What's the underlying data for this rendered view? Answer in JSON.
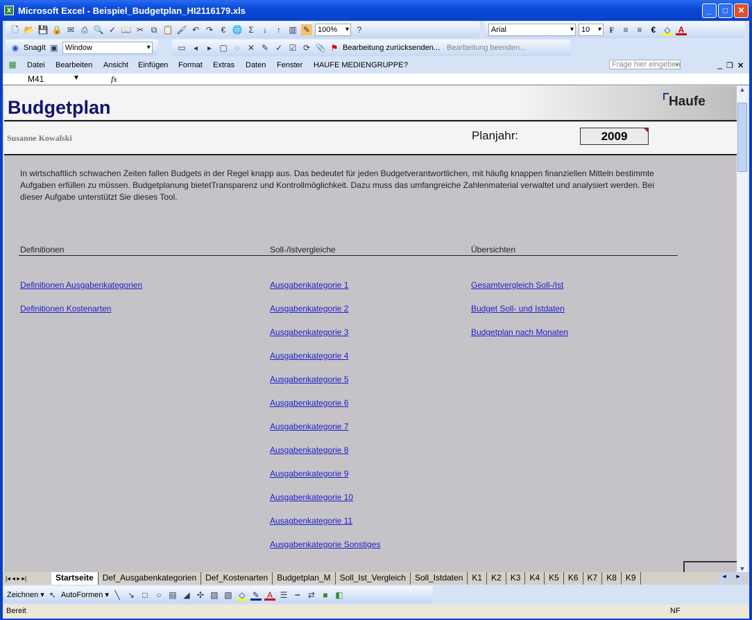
{
  "window": {
    "title": "Microsoft Excel - Beispiel_Budgetplan_HI2116179.xls"
  },
  "toolbar": {
    "zoom": "100%",
    "font": "Arial",
    "font_size": "10",
    "bold": "F",
    "euro": "€"
  },
  "toolbar2": {
    "snagit": "SnagIt",
    "window_combo": "Window",
    "send_back": "Bearbeitung zurücksenden...",
    "end_edit": "Bearbeitung beenden..."
  },
  "menu": {
    "items": [
      "Datei",
      "Bearbeiten",
      "Ansicht",
      "Einfügen",
      "Format",
      "Extras",
      "Daten",
      "Fenster",
      "HAUFE MEDIENGRUPPE",
      "?"
    ],
    "help_placeholder": "Frage hier eingeben"
  },
  "formula": {
    "cell_ref": "M41",
    "fx": "fx"
  },
  "sheet": {
    "title": "Budgetplan",
    "logo": "Haufe",
    "author": "Susanne Kowalski",
    "year_label": "Planjahr:",
    "year": "2009",
    "intro": [
      "In wirtschaftlich schwachen Zeiten fallen Budgets in der Regel knapp aus. Das bedeutet für jeden Budgetverantwortlichen, mit häufig knappen finanziellen Mitteln bestimmte",
      "Aufgaben erfüllen zu müssen. Budgetplanung bietetTransparenz und Kontrollmöglichkeit. Dazu muss das umfangreiche Zahlenmaterial verwaltet und analysiert werden. Bei",
      "dieser Aufgabe unterstützt Sie dieses Tool."
    ],
    "columns": [
      {
        "header": "Definitionen",
        "links": [
          "Definitionen Ausgabenkategorien",
          "Definitionen Kostenarten"
        ]
      },
      {
        "header": "Soll-/Istvergleiche",
        "links": [
          "Ausgabenkategorie 1",
          "Ausgabenkategorie 2",
          "Ausgabenkategorie 3",
          "Ausgabenkategorie 4",
          "Ausgabenkategorie 5",
          "Ausgabenkategorie 6",
          "Ausgabenkategorie 7",
          "Ausgabenkategorie 8",
          "Ausgabenkategorie 9",
          "Ausgabenkategorie 10",
          "Ausagbenkategorie 11",
          "Ausgabenkategorie Sonstiges"
        ]
      },
      {
        "header": "Übersichten",
        "links": [
          "Gesamtvergleich Soll-/Ist",
          "Budget Soll- und Istdaten",
          "Budgetplan nach Monaten"
        ]
      }
    ]
  },
  "tabs": [
    "Startseite",
    "Def_Ausgabenkategorien",
    "Def_Kostenarten",
    "Budgetplan_M",
    "Soll_Ist_Vergleich",
    "Soll_Istdaten",
    "K1",
    "K2",
    "K3",
    "K4",
    "K5",
    "K6",
    "K7",
    "K8",
    "K9"
  ],
  "drawing": {
    "draw": "Zeichnen ▾",
    "autoshapes": "AutoFormen ▾"
  },
  "status": {
    "text": "Bereit",
    "nf": "NF"
  }
}
